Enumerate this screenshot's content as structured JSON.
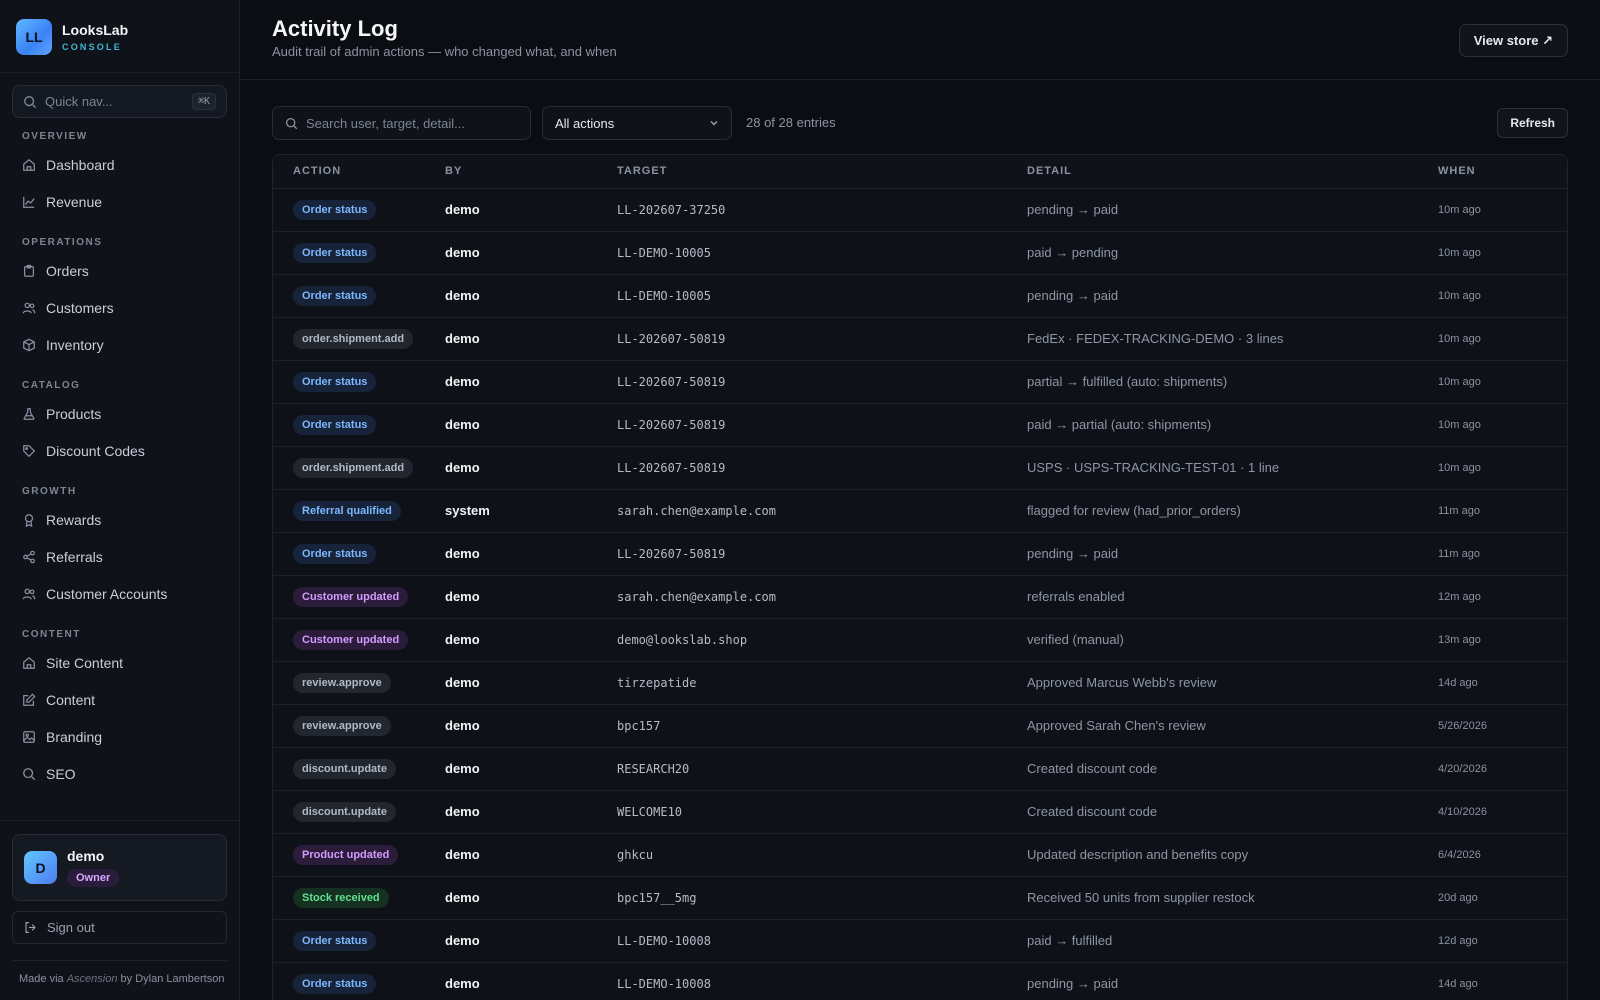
{
  "brand": {
    "logo": "LL",
    "name": "LooksLab",
    "sub": "CONSOLE"
  },
  "quicknav": {
    "label": "Quick nav...",
    "shortcut": "⌘K"
  },
  "nav": {
    "overview": "OVERVIEW",
    "dashboard": "Dashboard",
    "revenue": "Revenue",
    "operations": "OPERATIONS",
    "orders": "Orders",
    "customers": "Customers",
    "inventory": "Inventory",
    "catalog": "CATALOG",
    "products": "Products",
    "discount_codes": "Discount Codes",
    "growth": "GROWTH",
    "rewards": "Rewards",
    "referrals": "Referrals",
    "customer_accounts": "Customer Accounts",
    "content": "CONTENT",
    "site_content": "Site Content",
    "content_item": "Content",
    "branding": "Branding",
    "seo": "SEO"
  },
  "user": {
    "initial": "D",
    "name": "demo",
    "role": "Owner"
  },
  "signout": "Sign out",
  "footer": {
    "prefix": "Made via",
    "tool": "Ascension",
    "suffix": "by Dylan Lambertson"
  },
  "header": {
    "title": "Activity Log",
    "subtitle": "Audit trail of admin actions — who changed what, and when",
    "view_store": "View store ↗"
  },
  "toolbar": {
    "search_placeholder": "Search user, target, detail...",
    "filter_value": "All actions",
    "count": "28 of 28 entries",
    "refresh": "Refresh"
  },
  "table": {
    "headers": [
      "ACTION",
      "BY",
      "TARGET",
      "DETAIL",
      "WHEN"
    ],
    "rows": [
      {
        "action": "Order status",
        "kind": "blue",
        "by": "demo",
        "target": "LL-202607-37250",
        "detail": "pending → paid",
        "when": "10m ago"
      },
      {
        "action": "Order status",
        "kind": "blue",
        "by": "demo",
        "target": "LL-DEMO-10005",
        "detail": "paid → pending",
        "when": "10m ago"
      },
      {
        "action": "Order status",
        "kind": "blue",
        "by": "demo",
        "target": "LL-DEMO-10005",
        "detail": "pending → paid",
        "when": "10m ago"
      },
      {
        "action": "order.shipment.add",
        "kind": "gray",
        "by": "demo",
        "target": "LL-202607-50819",
        "detail": "FedEx · FEDEX-TRACKING-DEMO · 3 lines",
        "when": "10m ago"
      },
      {
        "action": "Order status",
        "kind": "blue",
        "by": "demo",
        "target": "LL-202607-50819",
        "detail": "partial → fulfilled (auto: shipments)",
        "when": "10m ago"
      },
      {
        "action": "Order status",
        "kind": "blue",
        "by": "demo",
        "target": "LL-202607-50819",
        "detail": "paid → partial (auto: shipments)",
        "when": "10m ago"
      },
      {
        "action": "order.shipment.add",
        "kind": "gray",
        "by": "demo",
        "target": "LL-202607-50819",
        "detail": "USPS · USPS-TRACKING-TEST-01 · 1 line",
        "when": "10m ago"
      },
      {
        "action": "Referral qualified",
        "kind": "blue",
        "by": "system",
        "target": "sarah.chen@example.com",
        "detail": "flagged for review (had_prior_orders)",
        "when": "11m ago"
      },
      {
        "action": "Order status",
        "kind": "blue",
        "by": "demo",
        "target": "LL-202607-50819",
        "detail": "pending → paid",
        "when": "11m ago"
      },
      {
        "action": "Customer updated",
        "kind": "purple",
        "by": "demo",
        "target": "sarah.chen@example.com",
        "detail": "referrals enabled",
        "when": "12m ago"
      },
      {
        "action": "Customer updated",
        "kind": "purple",
        "by": "demo",
        "target": "demo@lookslab.shop",
        "detail": "verified (manual)",
        "when": "13m ago"
      },
      {
        "action": "review.approve",
        "kind": "gray",
        "by": "demo",
        "target": "tirzepatide",
        "detail": "Approved Marcus Webb's review",
        "when": "14d ago"
      },
      {
        "action": "review.approve",
        "kind": "gray",
        "by": "demo",
        "target": "bpc157",
        "detail": "Approved Sarah Chen's review",
        "when": "5/26/2026"
      },
      {
        "action": "discount.update",
        "kind": "gray",
        "by": "demo",
        "target": "RESEARCH20",
        "detail": "Created discount code",
        "when": "4/20/2026"
      },
      {
        "action": "discount.update",
        "kind": "gray",
        "by": "demo",
        "target": "WELCOME10",
        "detail": "Created discount code",
        "when": "4/10/2026"
      },
      {
        "action": "Product updated",
        "kind": "purple",
        "by": "demo",
        "target": "ghkcu",
        "detail": "Updated description and benefits copy",
        "when": "6/4/2026"
      },
      {
        "action": "Stock received",
        "kind": "green",
        "by": "demo",
        "target": "bpc157__5mg",
        "detail": "Received 50 units from supplier restock",
        "when": "20d ago"
      },
      {
        "action": "Order status",
        "kind": "blue",
        "by": "demo",
        "target": "LL-DEMO-10008",
        "detail": "paid → fulfilled",
        "when": "12d ago"
      },
      {
        "action": "Order status",
        "kind": "blue",
        "by": "demo",
        "target": "LL-DEMO-10008",
        "detail": "pending → paid",
        "when": "14d ago"
      }
    ]
  }
}
